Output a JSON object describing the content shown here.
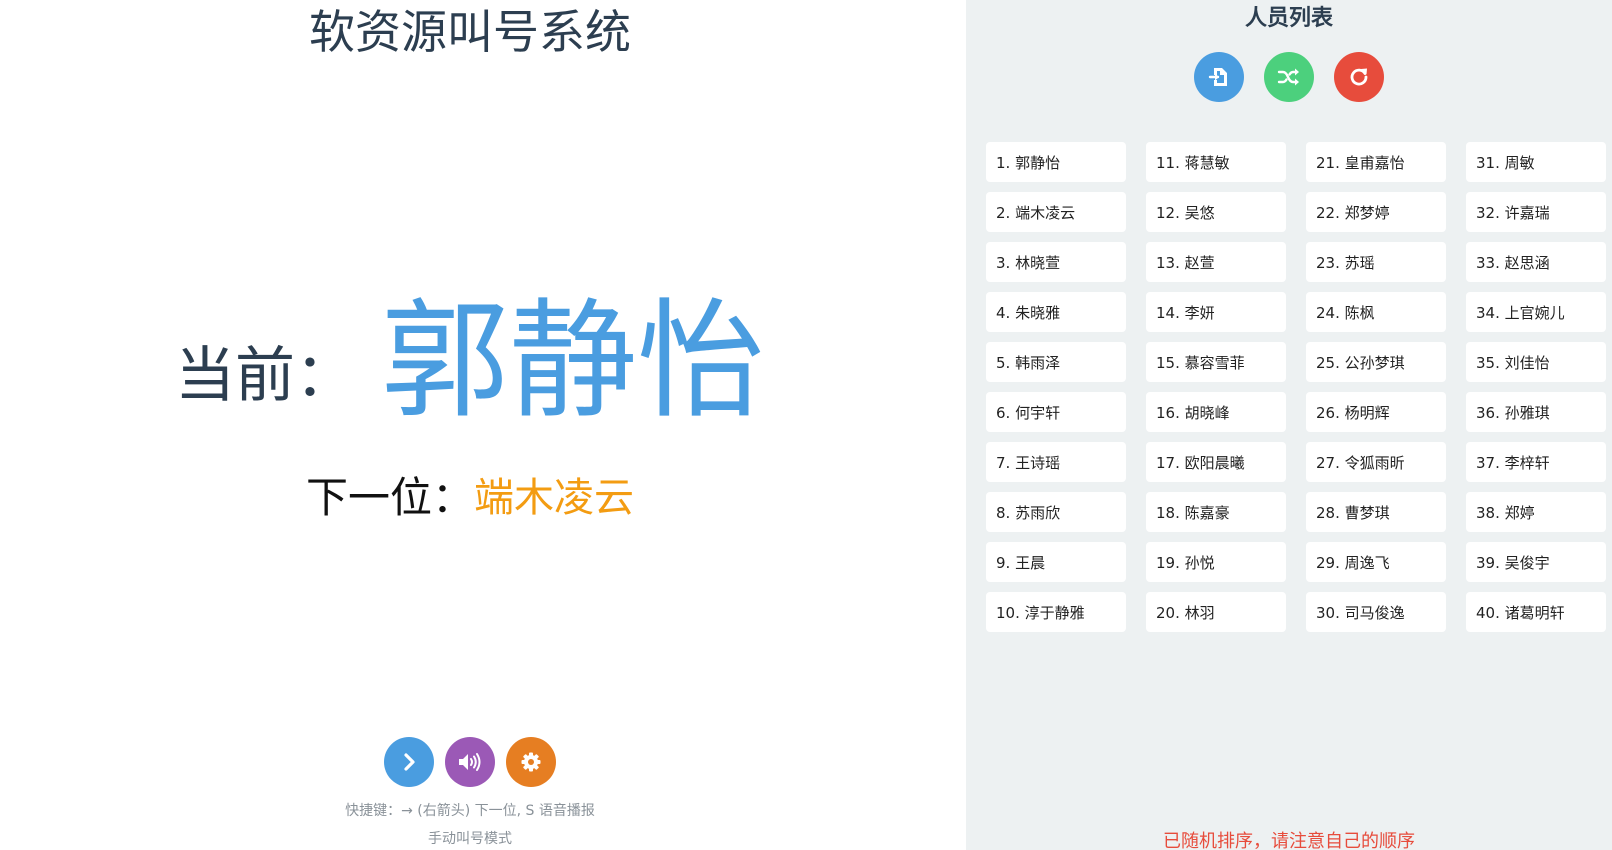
{
  "main": {
    "title": "软资源叫号系统",
    "current_label": "当前：",
    "current_name": "郭静怡",
    "next_label": "下一位：",
    "next_name": "端木凌云",
    "controls": [
      {
        "icon": "chevron-right-icon",
        "color": "#4a9de0"
      },
      {
        "icon": "speaker-icon",
        "color": "#9b59b6"
      },
      {
        "icon": "gear-icon",
        "color": "#e67e22"
      }
    ],
    "hint": "快捷键：→ (右箭头) 下一位, S 语音播报",
    "mode": "手动叫号模式"
  },
  "list": {
    "title": "人员列表",
    "buttons": [
      {
        "icon": "file-import-icon",
        "color": "#4a9de0"
      },
      {
        "icon": "shuffle-icon",
        "color": "#4cd07d"
      },
      {
        "icon": "refresh-icon",
        "color": "#e74c3c"
      }
    ],
    "columns": [
      [
        "1. 郭静怡",
        "2. 端木凌云",
        "3. 林晓萱",
        "4. 朱晓雅",
        "5. 韩雨泽",
        "6. 何宇轩",
        "7. 王诗瑶",
        "8. 苏雨欣",
        "9. 王晨",
        "10. 淳于静雅"
      ],
      [
        "11. 蒋慧敏",
        "12. 吴悠",
        "13. 赵萱",
        "14. 李妍",
        "15. 慕容雪菲",
        "16. 胡晓峰",
        "17. 欧阳晨曦",
        "18. 陈嘉豪",
        "19. 孙悦",
        "20. 林羽"
      ],
      [
        "21. 皇甫嘉怡",
        "22. 郑梦婷",
        "23. 苏瑶",
        "24. 陈枫",
        "25. 公孙梦琪",
        "26. 杨明辉",
        "27. 令狐雨昕",
        "28. 曹梦琪",
        "29. 周逸飞",
        "30. 司马俊逸"
      ],
      [
        "31. 周敏",
        "32. 许嘉瑞",
        "33. 赵思涵",
        "34. 上官婉儿",
        "35. 刘佳怡",
        "36. 孙雅琪",
        "37. 李梓轩",
        "38. 郑婷",
        "39. 吴俊宇",
        "40. 诸葛明轩"
      ]
    ],
    "notice": "已随机排序，请注意自己的顺序"
  }
}
